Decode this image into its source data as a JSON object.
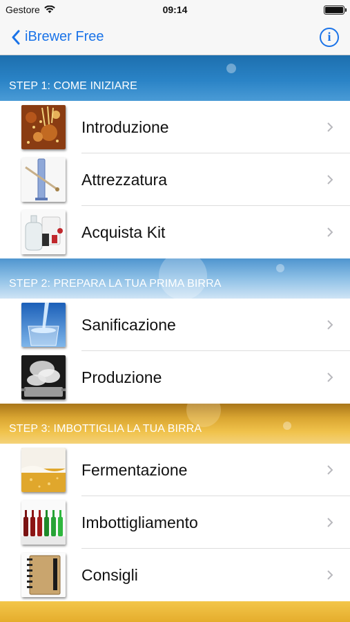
{
  "status_bar": {
    "carrier": "Gestore",
    "time": "09:14"
  },
  "nav": {
    "back_label": "iBrewer Free",
    "info_label": "i"
  },
  "sections": [
    {
      "title": "STEP 1: COME INIZIARE",
      "items": [
        {
          "label": "Introduzione",
          "icon": "malt-hops-icon"
        },
        {
          "label": "Attrezzatura",
          "icon": "hydrometer-icon"
        },
        {
          "label": "Acquista Kit",
          "icon": "brewing-kit-icon"
        }
      ]
    },
    {
      "title": "STEP 2: PREPARA LA TUA PRIMA BIRRA",
      "items": [
        {
          "label": "Sanificazione",
          "icon": "water-glass-icon"
        },
        {
          "label": "Produzione",
          "icon": "boiling-pot-icon"
        }
      ]
    },
    {
      "title": "STEP 3: IMBOTTIGLIA LA TUA BIRRA",
      "items": [
        {
          "label": "Fermentazione",
          "icon": "beer-foam-icon"
        },
        {
          "label": "Imbottigliamento",
          "icon": "bottles-icon"
        },
        {
          "label": "Consigli",
          "icon": "notebook-icon"
        }
      ]
    }
  ],
  "colors": {
    "accent": "#1a73e8",
    "section1": "#1d6fae",
    "section2": "#8ec0e6",
    "section3": "#e6b034"
  }
}
